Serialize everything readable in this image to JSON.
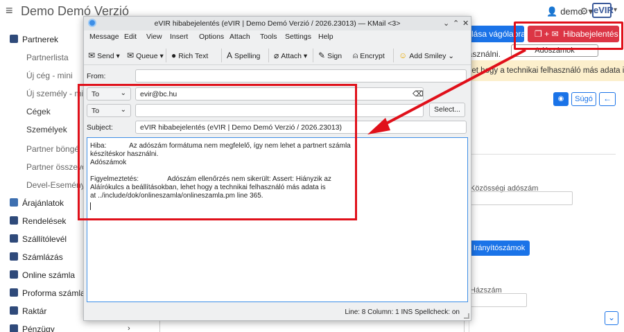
{
  "app": {
    "title": "Demo Demó Verzió",
    "user": "demo",
    "logo": "eVIR"
  },
  "sidebar": {
    "items": [
      {
        "label": "Partnerek",
        "type": "header",
        "icon": "building-icon"
      },
      {
        "label": "Partnerlista",
        "type": "sub"
      },
      {
        "label": "Új cég - mini",
        "type": "sub"
      },
      {
        "label": "Új személy - mi",
        "type": "sub"
      },
      {
        "label": "Cégek",
        "type": "sub-dark"
      },
      {
        "label": "Személyek",
        "type": "sub-dark"
      },
      {
        "label": "Partner böngé",
        "type": "sub"
      },
      {
        "label": "Partner összevo",
        "type": "sub"
      },
      {
        "label": "Devel-Esemény",
        "type": "sub"
      },
      {
        "label": "Árajánlatok",
        "type": "header",
        "icon": "handshake-icon"
      },
      {
        "label": "Rendelések",
        "type": "header",
        "icon": "doc-icon"
      },
      {
        "label": "Szállítólevél",
        "type": "header",
        "icon": "clipboard-icon"
      },
      {
        "label": "Számlázás",
        "type": "header",
        "icon": "invoice-icon"
      },
      {
        "label": "Online számla",
        "type": "header",
        "icon": "globe-icon"
      },
      {
        "label": "Proforma számla",
        "type": "header",
        "icon": "proforma-icon"
      },
      {
        "label": "Raktár",
        "type": "header",
        "icon": "warehouse-icon"
      },
      {
        "label": "Pénzügy",
        "type": "header",
        "icon": "money-icon"
      }
    ]
  },
  "bg": {
    "copy_button": "lása vágólapra",
    "bug_button": "Hibabejelentés",
    "text1": "használni.",
    "adoszam_button": "Adószámok",
    "warning_text": "het hogy a technikai felhasználó más adata is",
    "help_label": "Súgó",
    "kozossegi_label": "Közösségi adószám",
    "iranyito_button": "Irányítószámok",
    "hazszam_label": "Házszám"
  },
  "kmail": {
    "title": "eVIR hibabejelentés (eVIR | Demo Demó Verzió / 2026.23013) — KMail <3>",
    "menu": [
      "Message",
      "Edit",
      "View",
      "Insert",
      "Options",
      "Attach",
      "Tools",
      "Settings",
      "Help"
    ],
    "toolbar": {
      "send": "Send",
      "queue": "Queue",
      "rich_text": "Rich Text",
      "spelling": "Spelling",
      "attach": "Attach",
      "sign": "Sign",
      "encrypt": "Encrypt",
      "add_smiley": "Add Smiley"
    },
    "from_label": "From:",
    "from_value": "",
    "to1_type": "To",
    "to1_value": "evir@bc.hu",
    "to2_type": "To",
    "to2_value": "",
    "select_button": "Select...",
    "subject_label": "Subject:",
    "subject_value": "eVIR hibabejelentés (eVIR | Demo Demó Verzió / 2026.23013)",
    "body_lines": [
      "Hiba:            Az adószám formátuma nem megfelelő, így nem lehet a partnert számla",
      "készítéskor használni.",
      "Adószámok",
      "",
      "Figyelmeztetés:               Adószám ellenőrzés nem sikerült: Assert: Hiányzik az",
      "Aláírókulcs a beállításokban, lehet hogy a technikai felhasználó más adata is",
      "at ../include/dok/onlineszamla/onlineszamla.pm line 365."
    ],
    "status": "Line: 8   Column: 1   INS   Spellcheck: on"
  },
  "colors": {
    "highlight": "#e0101a",
    "accent": "#1a73e8",
    "danger": "#dc3545"
  }
}
